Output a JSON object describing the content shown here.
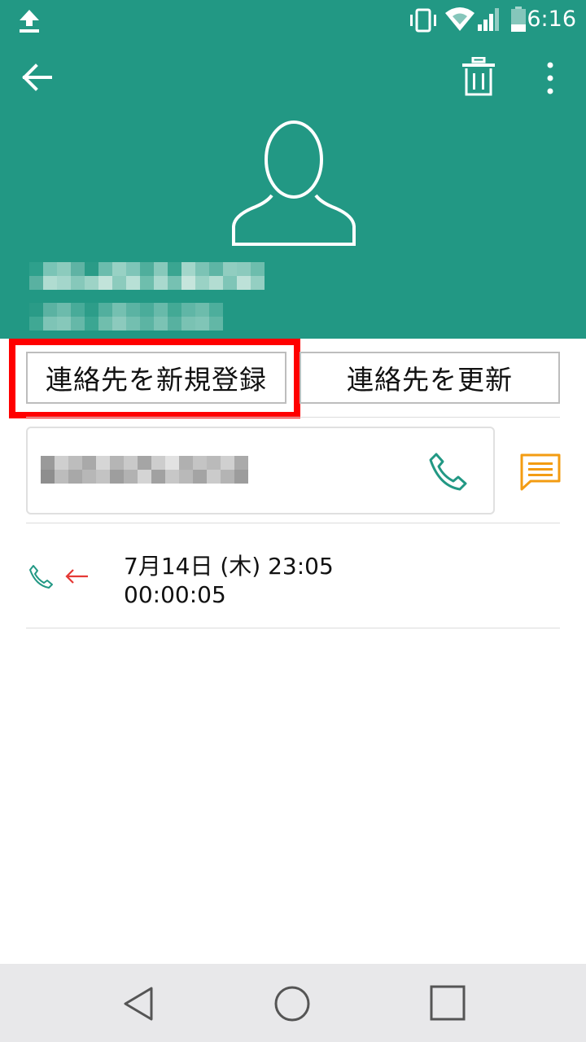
{
  "status_bar": {
    "time": "6:16",
    "upload_icon": "upload-icon",
    "vibrate_icon": "vibrate-icon",
    "wifi_icon": "wifi-icon",
    "signal_icon": "signal-icon",
    "battery_icon": "battery-icon"
  },
  "toolbar": {
    "back_icon": "arrow-left-icon",
    "delete_icon": "trash-icon",
    "more_icon": "more-vertical-icon"
  },
  "contact": {
    "avatar_icon": "person-outline-icon"
  },
  "actions": {
    "new_contact_label": "連絡先を新規登録",
    "update_contact_label": "連絡先を更新"
  },
  "phone_entry": {
    "call_icon": "phone-icon",
    "message_icon": "message-icon"
  },
  "call_log": {
    "date": "7月14日 (木) 23:05",
    "duration": "00:00:05",
    "type_icon": "incoming-call-icon"
  },
  "nav": {
    "back_icon": "nav-back-icon",
    "home_icon": "nav-home-icon",
    "recents_icon": "nav-recents-icon"
  },
  "colors": {
    "header": "#229884",
    "highlight": "#ff0000",
    "accent_orange": "#f39c12",
    "teal_icon": "#229884",
    "incoming_arrow": "#e53935"
  }
}
